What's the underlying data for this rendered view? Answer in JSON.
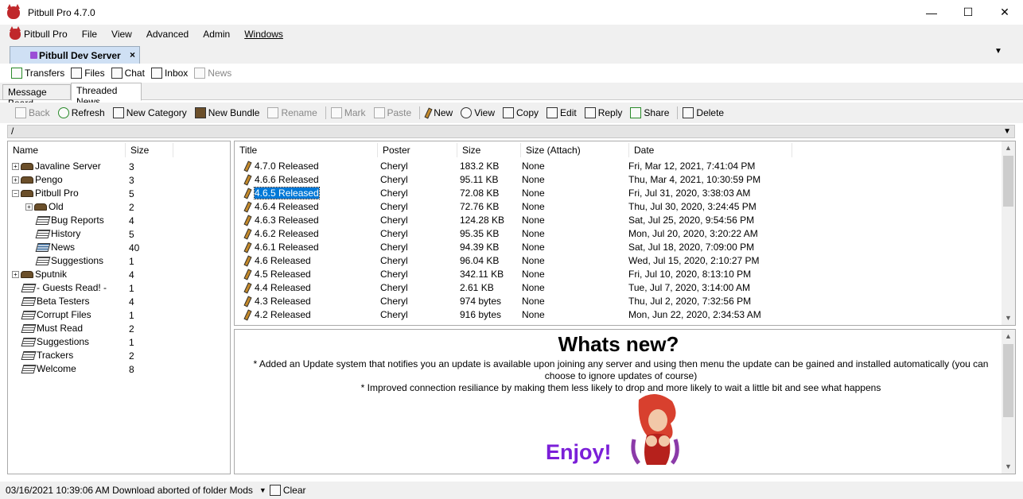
{
  "window": {
    "title": "Pitbull Pro 4.7.0",
    "controls": [
      "—",
      "☐",
      "✕"
    ]
  },
  "menu": [
    "Pitbull Pro",
    "File",
    "View",
    "Advanced",
    "Admin",
    "Windows"
  ],
  "doc_tab": {
    "label": "Pitbull Dev Server",
    "close": "×"
  },
  "toolbar1": [
    "Transfers",
    "Files",
    "Chat",
    "Inbox",
    "News"
  ],
  "subtabs": [
    "Message Board",
    "Threaded News"
  ],
  "toolbar2": [
    "Back",
    "Refresh",
    "New Category",
    "New Bundle",
    "Rename",
    "Mark",
    "Paste",
    "New",
    "View",
    "Copy",
    "Edit",
    "Reply",
    "Share",
    "Delete"
  ],
  "path": "/",
  "tree": {
    "headers": [
      "Name",
      "Size"
    ],
    "rows": [
      {
        "name": "Javaline Server",
        "size": "3"
      },
      {
        "name": "Pengo",
        "size": "3"
      },
      {
        "name": "Pitbull Pro",
        "size": "5"
      },
      {
        "name": "Old",
        "size": "2"
      },
      {
        "name": "Bug Reports",
        "size": "4"
      },
      {
        "name": "History",
        "size": "5"
      },
      {
        "name": "News",
        "size": "40"
      },
      {
        "name": "Suggestions",
        "size": "1"
      },
      {
        "name": "Sputnik",
        "size": "4"
      },
      {
        "name": "- Guests Read! -",
        "size": "1"
      },
      {
        "name": "Beta Testers",
        "size": "4"
      },
      {
        "name": "Corrupt Files",
        "size": "1"
      },
      {
        "name": "Must Read",
        "size": "2"
      },
      {
        "name": "Suggestions",
        "size": "1"
      },
      {
        "name": "Trackers",
        "size": "2"
      },
      {
        "name": "Welcome",
        "size": "8"
      }
    ]
  },
  "articles": {
    "headers": [
      "Title",
      "Poster",
      "Size",
      "Size (Attach)",
      "Date"
    ],
    "rows": [
      {
        "title": "4.7.0 Released",
        "poster": "Cheryl",
        "size": "183.2 KB",
        "attach": "None",
        "date": "Fri, Mar 12, 2021, 7:41:04 PM"
      },
      {
        "title": "4.6.6 Released",
        "poster": "Cheryl",
        "size": "95.11 KB",
        "attach": "None",
        "date": "Thu, Mar 4, 2021, 10:30:59 PM"
      },
      {
        "title": "4.6.5 Released",
        "poster": "Cheryl",
        "size": "72.08 KB",
        "attach": "None",
        "date": "Fri, Jul 31, 2020, 3:38:03 AM"
      },
      {
        "title": "4.6.4 Released",
        "poster": "Cheryl",
        "size": "72.76 KB",
        "attach": "None",
        "date": "Thu, Jul 30, 2020, 3:24:45 PM"
      },
      {
        "title": "4.6.3 Released",
        "poster": "Cheryl",
        "size": "124.28 KB",
        "attach": "None",
        "date": "Sat, Jul 25, 2020, 9:54:56 PM"
      },
      {
        "title": "4.6.2 Released",
        "poster": "Cheryl",
        "size": "95.35 KB",
        "attach": "None",
        "date": "Mon, Jul 20, 2020, 3:20:22 AM"
      },
      {
        "title": "4.6.1 Released",
        "poster": "Cheryl",
        "size": "94.39 KB",
        "attach": "None",
        "date": "Sat, Jul 18, 2020, 7:09:00 PM"
      },
      {
        "title": "4.6 Released",
        "poster": "Cheryl",
        "size": "96.04 KB",
        "attach": "None",
        "date": "Wed, Jul 15, 2020, 2:10:27 PM"
      },
      {
        "title": "4.5 Released",
        "poster": "Cheryl",
        "size": "342.11 KB",
        "attach": "None",
        "date": "Fri, Jul 10, 2020, 8:13:10 PM"
      },
      {
        "title": "4.4 Released",
        "poster": "Cheryl",
        "size": "2.61 KB",
        "attach": "None",
        "date": "Tue, Jul 7, 2020, 3:14:00 AM"
      },
      {
        "title": "4.3 Released",
        "poster": "Cheryl",
        "size": "974 bytes",
        "attach": "None",
        "date": "Thu, Jul 2, 2020, 7:32:56 PM"
      },
      {
        "title": "4.2 Released",
        "poster": "Cheryl",
        "size": "916 bytes",
        "attach": "None",
        "date": "Mon, Jun 22, 2020, 2:34:53 AM"
      }
    ]
  },
  "article_body": {
    "heading": "Whats new?",
    "line1": "* Added an Update system that notifies you an update is available upon joining any server and using then menu the update can be gained and installed automatically (you can choose to ignore updates of course)",
    "line2": "* Improved connection resiliance by making them less likely to drop and more likely to wait a little bit and see what happens",
    "enjoy": "Enjoy!"
  },
  "status": {
    "text": "03/16/2021 10:39:06 AM Download aborted of folder Mods",
    "clear": "Clear"
  }
}
